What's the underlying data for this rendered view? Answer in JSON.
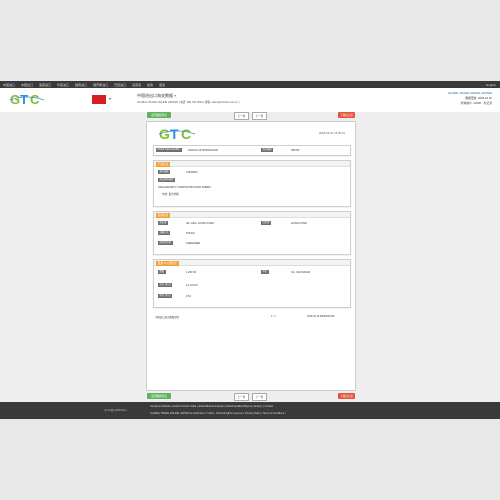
{
  "topnav": {
    "items": [
      "中国进口",
      "中国出口",
      "美国进口",
      "印度进口",
      "越南进口",
      "俄罗斯进口",
      "巴西进口",
      "墨西哥",
      "秘鲁",
      "更多"
    ],
    "right": "English"
  },
  "header": {
    "title": "中国进出口海关数据 »",
    "subtitle": "GLOBAL TRADE ONLINE LIMITED | 电话: 086 750 0000 | 邮箱: sales@cbsinfor.com.cn |",
    "brand": "GLOBAL TRADE ONLINE LIMITED",
    "right_line2": "数据更新: 2018.10.22",
    "right_line3": "查询用户: 12000 · 条记录"
  },
  "buttons": {
    "back_top": "返回数据列表",
    "prev": "上一条",
    "next": "下一条",
    "download": "下载该记录",
    "back_bottom": "返回数据列表"
  },
  "record": {
    "date": "2018-02-07 14:00:21",
    "id_label": "Global Trade Identifier",
    "id_value": "2018-03-15 00000043100",
    "hs_label": "海关编码",
    "hs_value": "283791"
  },
  "product": {
    "section": "产品信息",
    "desc_label": "报关描述",
    "desc_value": "27460000",
    "name_label": "商品编码描述",
    "line1": "HIGH-DENSITY COMPOSITE FOOD FABRIC",
    "line2": "中文: 复合布料"
  },
  "trade": {
    "section": "贸易信息",
    "origin_label": "起运港",
    "origin_value": "HK, HKG, HONG KONG",
    "dest_label": "目的港",
    "dest_value": "HONG KONG",
    "transport_label": "运输方式",
    "transport_value": "TRUCK",
    "port_label": "境内目的地",
    "port_value": "SHENZHEN"
  },
  "amount": {
    "section": "数量 & 价值信息",
    "qty_label": "数量",
    "qty_value": "1,297.00",
    "unit_label": "单位",
    "unit_value": "KG, KILOGRAM",
    "total_label": "总价 (美元)",
    "total_value": "12,179.00",
    "unit_price_label": "单价 (美元)",
    "unit_price_value": "0.51"
  },
  "footnote": {
    "left": "中国进口海关数据详情",
    "middle": "1 / 1",
    "right": "2018-03-15 00000043100"
  },
  "footer": {
    "left": "京ICP备14000000号",
    "links": "Company Website | Global Customs Data | Global Market Analysis | Global Qualified Buyers | Enquiry | Contact",
    "copy": "GLOBAL TRADE ONLINE LIMITED is authorized. © 2014 - 2018 All rights reserved.  |  Privacy Policy  |  Terms & Conditions  |"
  },
  "colors": {
    "nav": "#3a3a3a",
    "green": "#5fb35f",
    "red": "#e5533d",
    "orange": "#f3a23b",
    "flag": "#d71f1f"
  }
}
